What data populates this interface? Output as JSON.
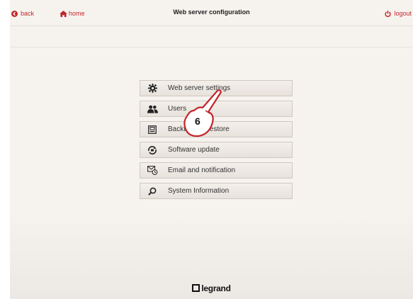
{
  "header": {
    "back_label": "back",
    "home_label": "home",
    "title": "Web server configuration",
    "logout_label": "logout"
  },
  "menu": {
    "items": [
      {
        "label": "Web server settings",
        "icon": "gear-icon"
      },
      {
        "label": "Users",
        "icon": "users-icon"
      },
      {
        "label": "Backup and restore",
        "icon": "backup-icon"
      },
      {
        "label": "Software update",
        "icon": "update-icon"
      },
      {
        "label": "Email and notification",
        "icon": "email-icon"
      },
      {
        "label": "System Information",
        "icon": "search-icon"
      }
    ]
  },
  "annotation": {
    "step_number": "6"
  },
  "footer": {
    "logo_text": "legrand"
  },
  "colors": {
    "accent": "#c3262b",
    "background": "#f6f3ef"
  }
}
